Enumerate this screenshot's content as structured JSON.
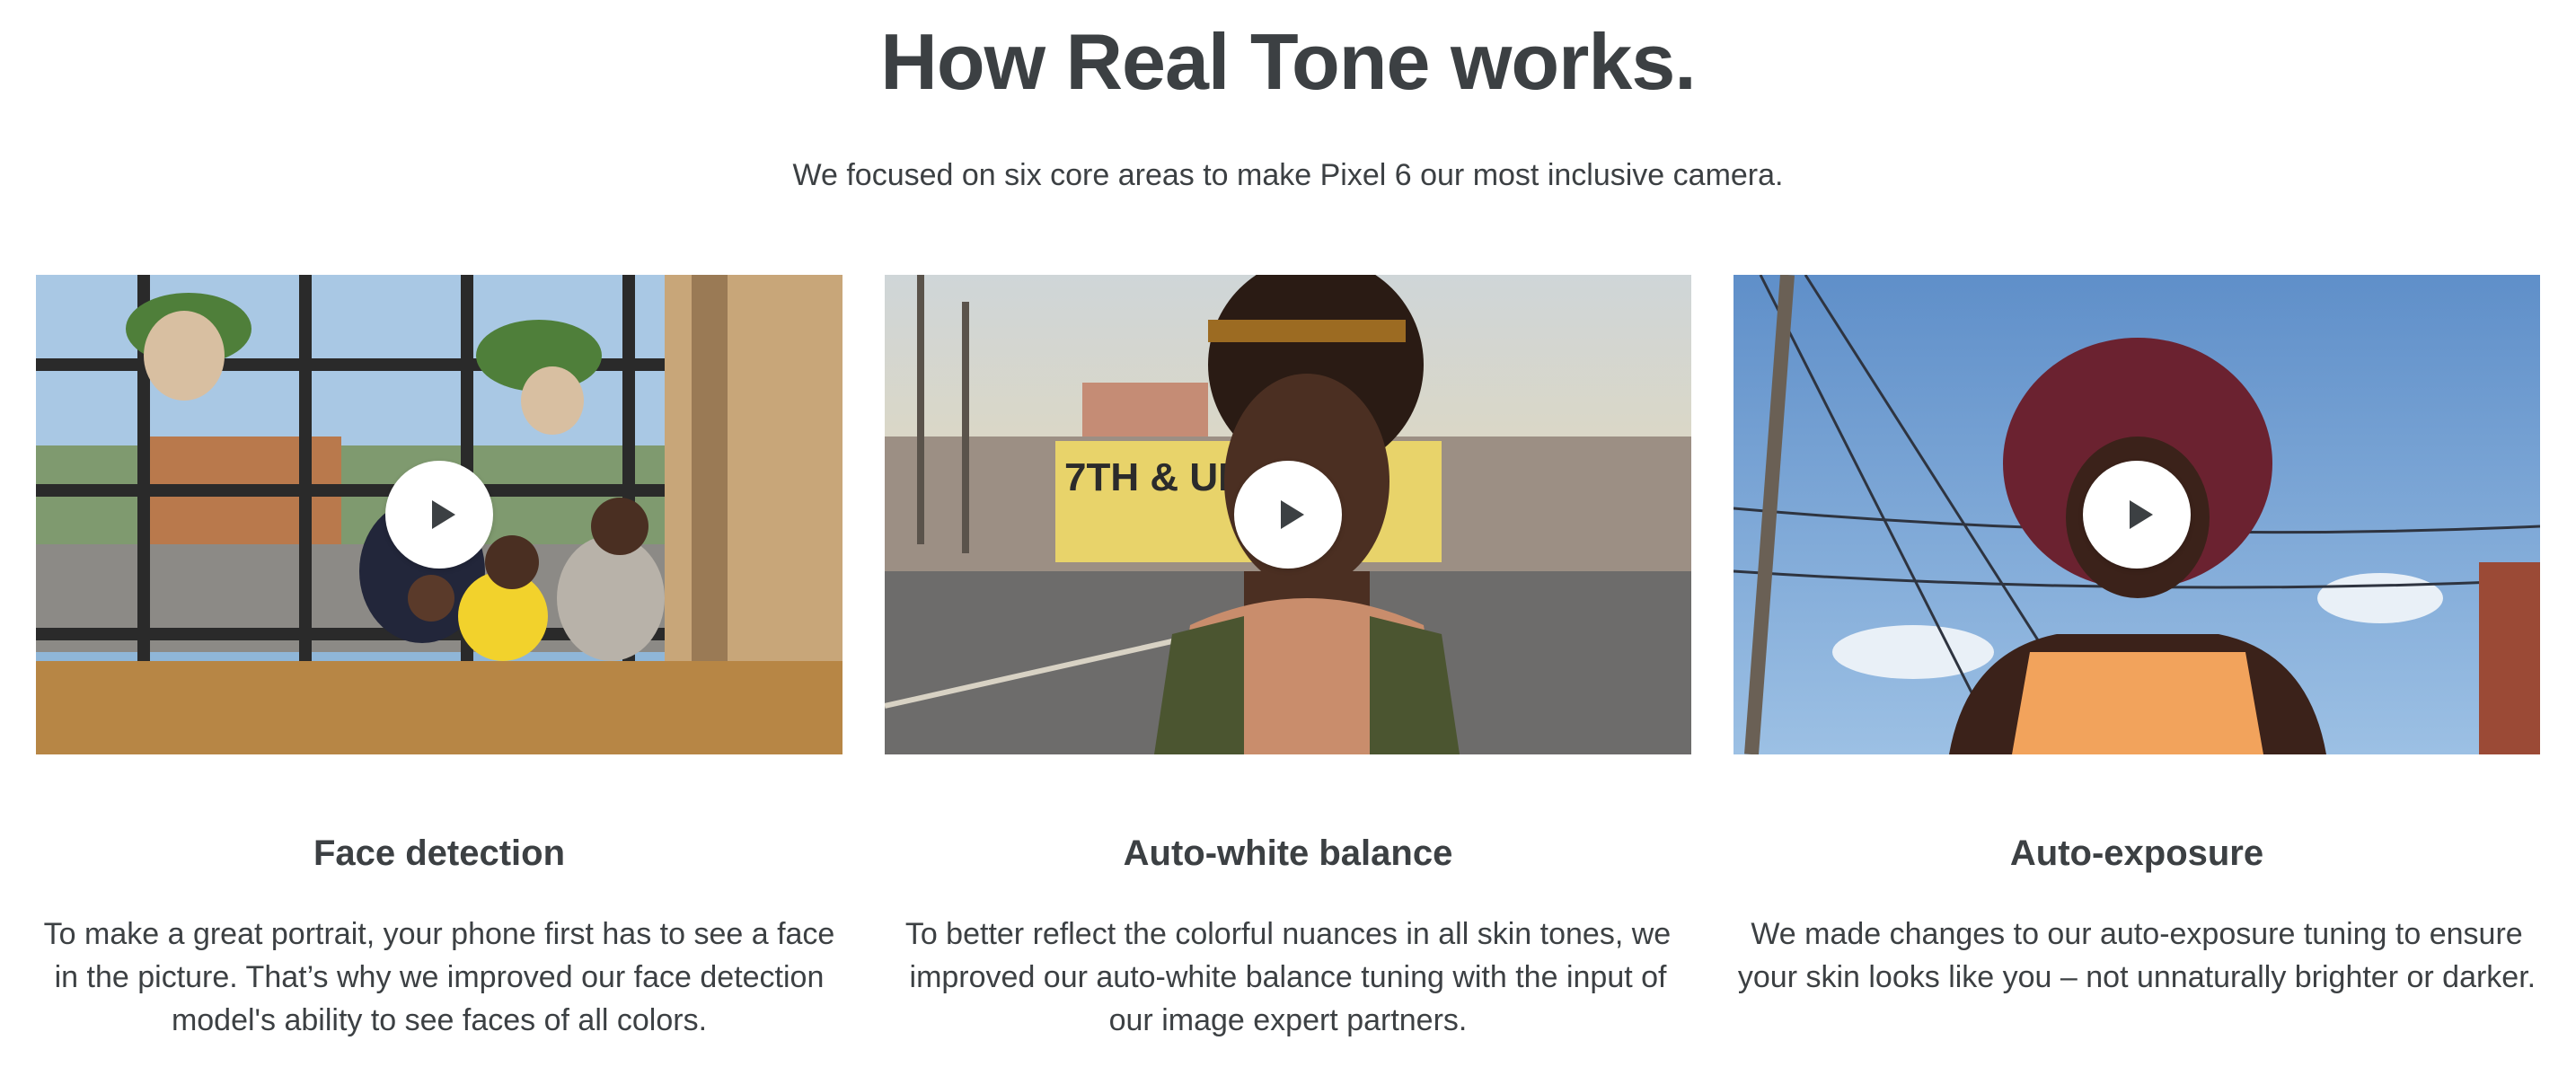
{
  "header": {
    "title": "How Real Tone works.",
    "subtitle": "We focused on six core areas to make Pixel 6 our most inclusive camera."
  },
  "cards": [
    {
      "title": "Face detection",
      "description": "To make a great portrait, your phone first has to see a face in the picture. That’s why we improved our face detection model's ability to see faces of all colors.",
      "image_sign": "",
      "play_icon": "play-icon"
    },
    {
      "title": "Auto-white balance",
      "description": "To better reflect the colorful nuances in all skin tones, we improved our auto-white balance tuning with the input of our image expert partners.",
      "image_sign": "7TH & UNION",
      "play_icon": "play-icon"
    },
    {
      "title": "Auto-exposure",
      "description": "We made changes to our auto-exposure tuning to ensure your skin looks like you – not unnaturally brighter or darker.",
      "image_sign": "",
      "play_icon": "play-icon"
    }
  ],
  "colors": {
    "text": "#3c4043",
    "background": "#ffffff",
    "play_button": "#ffffff"
  }
}
